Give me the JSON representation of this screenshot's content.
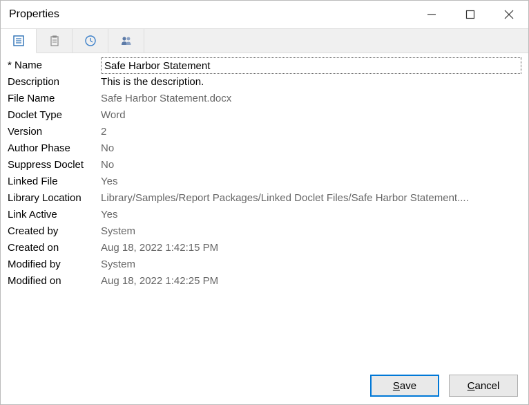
{
  "window": {
    "title": "Properties"
  },
  "fields": {
    "name": {
      "label": "* Name",
      "value": "Safe Harbor Statement"
    },
    "description": {
      "label": "Description",
      "value": "This is the description."
    },
    "fileName": {
      "label": "File Name",
      "value": "Safe Harbor Statement.docx"
    },
    "docletType": {
      "label": "Doclet Type",
      "value": "Word"
    },
    "version": {
      "label": "Version",
      "value": "2"
    },
    "authorPhase": {
      "label": "Author Phase",
      "value": "No"
    },
    "suppressDoclet": {
      "label": "Suppress Doclet",
      "value": "No"
    },
    "linkedFile": {
      "label": "Linked File",
      "value": "Yes"
    },
    "libraryLocation": {
      "label": "Library Location",
      "value": "Library/Samples/Report Packages/Linked Doclet Files/Safe Harbor Statement...."
    },
    "linkActive": {
      "label": "Link Active",
      "value": "Yes"
    },
    "createdBy": {
      "label": "Created by",
      "value": "System"
    },
    "createdOn": {
      "label": "Created on",
      "value": "Aug 18, 2022 1:42:15 PM"
    },
    "modifiedBy": {
      "label": "Modified by",
      "value": "System"
    },
    "modifiedOn": {
      "label": "Modified on",
      "value": "Aug 18, 2022 1:42:25 PM"
    }
  },
  "buttons": {
    "save": "Save",
    "cancel": "Cancel"
  },
  "icons": {
    "tab1": "properties-tab",
    "tab2": "clipboard-tab",
    "tab3": "history-tab",
    "tab4": "users-tab"
  }
}
